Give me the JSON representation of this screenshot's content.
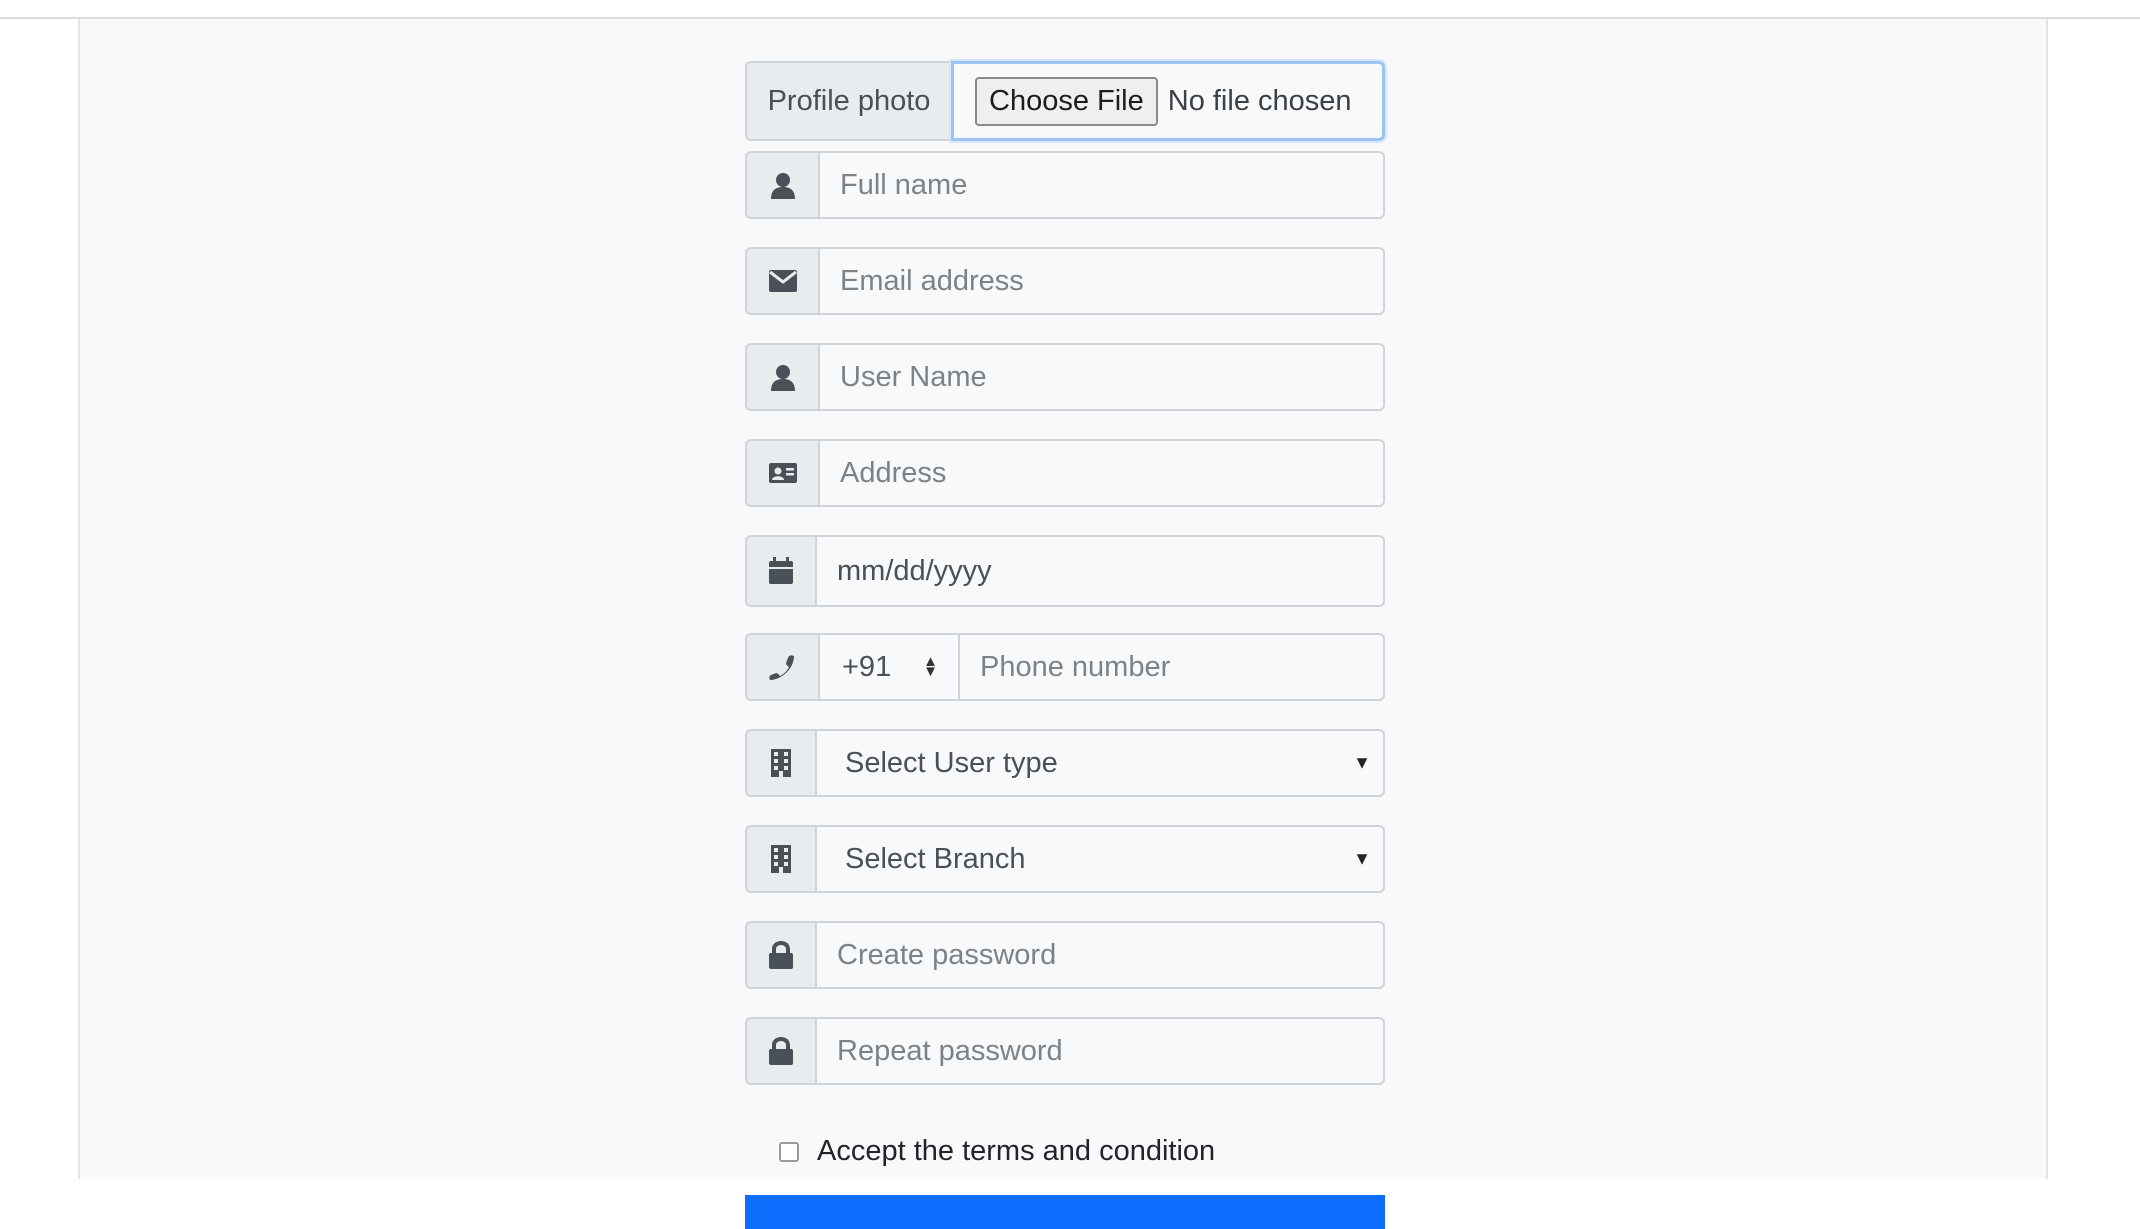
{
  "form": {
    "profile_photo": {
      "label": "Profile photo",
      "button_label": "Choose File",
      "status": "No file chosen"
    },
    "full_name": {
      "placeholder": "Full name",
      "icon": "user-icon"
    },
    "email": {
      "placeholder": "Email address",
      "icon": "envelope-icon"
    },
    "username": {
      "placeholder": "User Name",
      "icon": "user-icon"
    },
    "address": {
      "placeholder": "Address",
      "icon": "id-card-icon"
    },
    "dob": {
      "placeholder": "mm/dd/yyyy",
      "icon": "calendar-icon"
    },
    "phone": {
      "country_code": "+91",
      "placeholder": "Phone number",
      "icon": "phone-icon"
    },
    "user_type": {
      "selected": "Select User type",
      "icon": "building-icon"
    },
    "branch": {
      "selected": "Select Branch",
      "icon": "building-icon"
    },
    "password": {
      "placeholder": "Create password",
      "icon": "lock-icon"
    },
    "repeat_password": {
      "placeholder": "Repeat password",
      "icon": "lock-icon"
    },
    "terms_label": "Accept the terms and condition"
  },
  "colors": {
    "accent": "#0d6efd",
    "focus_border": "#9cc4f3",
    "addon_bg": "#e9ecef",
    "border": "#ced4da"
  }
}
